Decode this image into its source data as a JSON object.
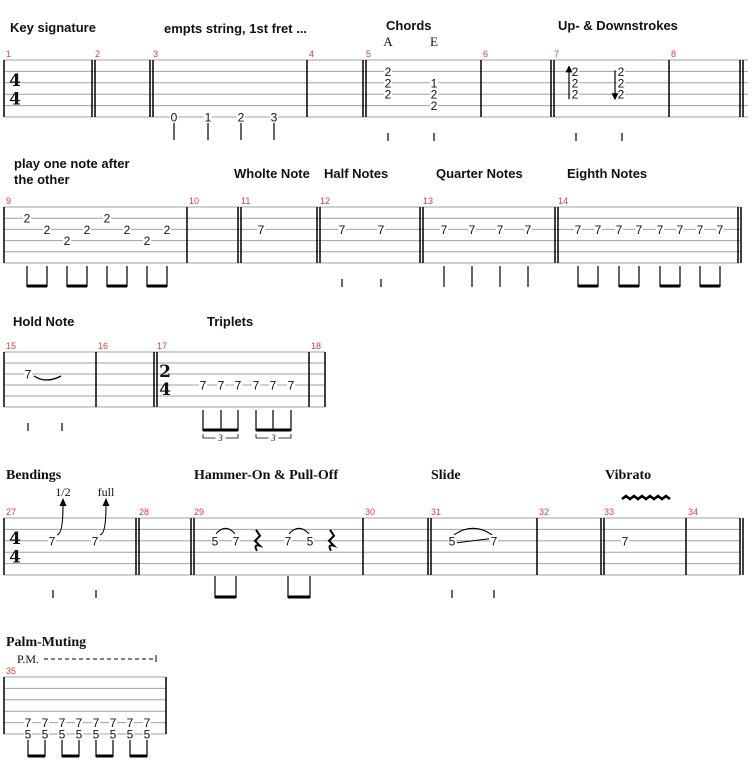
{
  "colors": {
    "staff_line": "#a0a0a0",
    "bar_line": "#000000",
    "bar_number": "#d9403a",
    "text": "#111111"
  },
  "rows": [
    {
      "id": "row1",
      "headings": [
        {
          "text": "Key signature",
          "style": "sans"
        },
        {
          "text": "empts string, 1st fret ...",
          "style": "sans"
        },
        {
          "text": "Chords",
          "style": "sans"
        },
        {
          "text": "Up- & Downstrokes",
          "style": "sans"
        }
      ],
      "chord_names": [
        "A",
        "E"
      ],
      "bars": [
        {
          "number": "1",
          "time_signature": [
            "4",
            "4"
          ],
          "notes": []
        },
        {
          "number": "2",
          "notes": []
        },
        {
          "number": "3",
          "notes": [
            {
              "fret": "0",
              "string": 6
            },
            {
              "fret": "1",
              "string": 6
            },
            {
              "fret": "2",
              "string": 6
            },
            {
              "fret": "3",
              "string": 6
            }
          ],
          "rhythm": "quarter"
        },
        {
          "number": "4",
          "notes": []
        },
        {
          "number": "5",
          "chords": [
            {
              "name": "A",
              "notes": [
                {
                  "fret": "2",
                  "string": 2
                },
                {
                  "fret": "2",
                  "string": 3
                },
                {
                  "fret": "2",
                  "string": 4
                }
              ]
            },
            {
              "name": "E",
              "notes": [
                {
                  "fret": "1",
                  "string": 3
                },
                {
                  "fret": "2",
                  "string": 4
                },
                {
                  "fret": "2",
                  "string": 5
                }
              ]
            }
          ],
          "rhythm": "quarter"
        },
        {
          "number": "6",
          "notes": []
        },
        {
          "number": "7",
          "chords": [
            {
              "stroke": "up",
              "notes": [
                {
                  "fret": "2",
                  "string": 2
                },
                {
                  "fret": "2",
                  "string": 3
                },
                {
                  "fret": "2",
                  "string": 4
                }
              ]
            },
            {
              "stroke": "down",
              "notes": [
                {
                  "fret": "2",
                  "string": 2
                },
                {
                  "fret": "2",
                  "string": 3
                },
                {
                  "fret": "2",
                  "string": 4
                }
              ]
            }
          ],
          "rhythm": "quarter"
        },
        {
          "number": "8",
          "notes": []
        }
      ]
    },
    {
      "id": "row2",
      "headings": [
        {
          "text": "play one note after",
          "style": "sans"
        },
        {
          "text": "the other",
          "style": "sans"
        },
        {
          "text": "Wholte Note",
          "style": "sans"
        },
        {
          "text": "Half Notes",
          "style": "sans"
        },
        {
          "text": "Quarter Notes",
          "style": "sans"
        },
        {
          "text": "Eighth Notes",
          "style": "sans"
        }
      ],
      "bars": [
        {
          "number": "9",
          "notes": [
            {
              "fret": "2",
              "string": 2
            },
            {
              "fret": "2",
              "string": 3
            },
            {
              "fret": "2",
              "string": 4
            },
            {
              "fret": "2",
              "string": 3
            },
            {
              "fret": "2",
              "string": 2
            },
            {
              "fret": "2",
              "string": 3
            },
            {
              "fret": "2",
              "string": 4
            },
            {
              "fret": "2",
              "string": 3
            }
          ],
          "rhythm": "eighth"
        },
        {
          "number": "10",
          "notes": []
        },
        {
          "number": "11",
          "notes": [
            {
              "fret": "7",
              "string": 3
            }
          ],
          "rhythm": "whole"
        },
        {
          "number": "12",
          "notes": [
            {
              "fret": "7",
              "string": 3
            },
            {
              "fret": "7",
              "string": 3
            }
          ],
          "rhythm": "half"
        },
        {
          "number": "13",
          "notes": [
            {
              "fret": "7",
              "string": 3
            },
            {
              "fret": "7",
              "string": 3
            },
            {
              "fret": "7",
              "string": 3
            },
            {
              "fret": "7",
              "string": 3
            }
          ],
          "rhythm": "quarter"
        },
        {
          "number": "14",
          "notes": [
            {
              "fret": "7",
              "string": 3
            },
            {
              "fret": "7",
              "string": 3
            },
            {
              "fret": "7",
              "string": 3
            },
            {
              "fret": "7",
              "string": 3
            },
            {
              "fret": "7",
              "string": 3
            },
            {
              "fret": "7",
              "string": 3
            },
            {
              "fret": "7",
              "string": 3
            },
            {
              "fret": "7",
              "string": 3
            }
          ],
          "rhythm": "eighth"
        }
      ]
    },
    {
      "id": "row3",
      "headings": [
        {
          "text": "Hold Note",
          "style": "sans"
        },
        {
          "text": "Triplets",
          "style": "sans"
        }
      ],
      "bars": [
        {
          "number": "15",
          "notes": [
            {
              "fret": "7",
              "string": 3,
              "tie": true
            }
          ],
          "rhythm": "half"
        },
        {
          "number": "16",
          "notes": []
        },
        {
          "number": "17",
          "time_signature": [
            "2",
            "4"
          ],
          "notes": [
            {
              "fret": "7",
              "string": 4
            },
            {
              "fret": "7",
              "string": 4
            },
            {
              "fret": "7",
              "string": 4
            },
            {
              "fret": "7",
              "string": 4
            },
            {
              "fret": "7",
              "string": 4
            },
            {
              "fret": "7",
              "string": 4
            }
          ],
          "rhythm": "triplet",
          "tuplet_label": "3"
        },
        {
          "number": "18",
          "notes": []
        }
      ]
    },
    {
      "id": "row4",
      "headings": [
        {
          "text": "Bendings",
          "style": "serif"
        },
        {
          "text": "Hammer-On & Pull-Off",
          "style": "serif"
        },
        {
          "text": "Slide",
          "style": "serif"
        },
        {
          "text": "Vibrato",
          "style": "serif"
        }
      ],
      "bars": [
        {
          "number": "27",
          "time_signature": [
            "4",
            "4"
          ],
          "notes": [
            {
              "fret": "7",
              "string": 3,
              "bend": "1/2"
            },
            {
              "fret": "7",
              "string": 3,
              "bend": "full"
            }
          ],
          "rhythm": "quarter"
        },
        {
          "number": "28",
          "notes": []
        },
        {
          "number": "29",
          "notes": [
            {
              "fret": "5",
              "string": 3
            },
            {
              "fret": "7",
              "string": 3,
              "technique": "hammer-on"
            },
            {
              "rest": "quarter"
            },
            {
              "fret": "7",
              "string": 3
            },
            {
              "fret": "5",
              "string": 3,
              "technique": "pull-off"
            },
            {
              "rest": "quarter"
            }
          ],
          "rhythm": "eighth"
        },
        {
          "number": "30",
          "notes": []
        },
        {
          "number": "31",
          "notes": [
            {
              "fret": "5",
              "string": 3
            },
            {
              "fret": "7",
              "string": 3,
              "technique": "slide"
            }
          ],
          "rhythm": "quarter"
        },
        {
          "number": "32",
          "notes": []
        },
        {
          "number": "33",
          "notes": [
            {
              "fret": "7",
              "string": 3,
              "vibrato": true
            }
          ],
          "rhythm": "whole"
        },
        {
          "number": "34",
          "notes": []
        }
      ]
    },
    {
      "id": "row5",
      "headings": [
        {
          "text": "Palm-Muting",
          "style": "serif"
        }
      ],
      "palm_mute_label": "P.M.",
      "bars": [
        {
          "number": "35",
          "notes": [
            {
              "frets": [
                "7",
                "5"
              ],
              "strings": [
                5,
                6
              ]
            },
            {
              "frets": [
                "7",
                "5"
              ],
              "strings": [
                5,
                6
              ]
            },
            {
              "frets": [
                "7",
                "5"
              ],
              "strings": [
                5,
                6
              ]
            },
            {
              "frets": [
                "7",
                "5"
              ],
              "strings": [
                5,
                6
              ]
            },
            {
              "frets": [
                "7",
                "5"
              ],
              "strings": [
                5,
                6
              ]
            },
            {
              "frets": [
                "7",
                "5"
              ],
              "strings": [
                5,
                6
              ]
            },
            {
              "frets": [
                "7",
                "5"
              ],
              "strings": [
                5,
                6
              ]
            },
            {
              "frets": [
                "7",
                "5"
              ],
              "strings": [
                5,
                6
              ]
            }
          ],
          "rhythm": "eighth",
          "palm_mute": true
        }
      ]
    }
  ]
}
